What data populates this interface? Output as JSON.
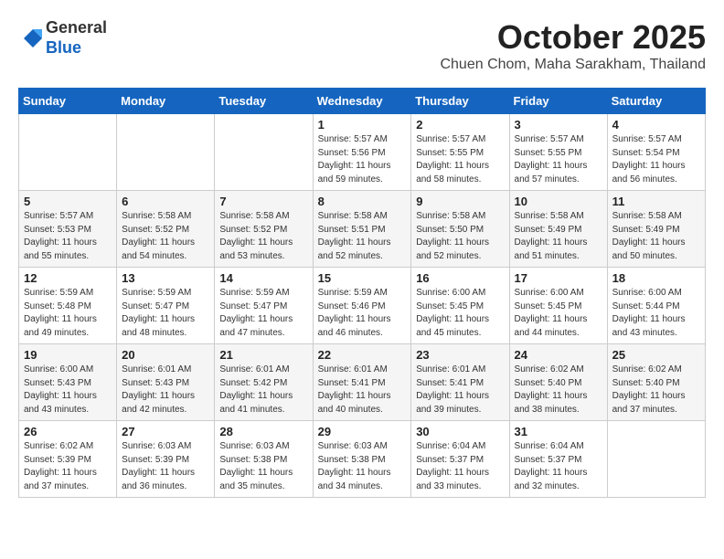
{
  "header": {
    "logo_general": "General",
    "logo_blue": "Blue",
    "month": "October 2025",
    "location": "Chuen Chom, Maha Sarakham, Thailand"
  },
  "days_of_week": [
    "Sunday",
    "Monday",
    "Tuesday",
    "Wednesday",
    "Thursday",
    "Friday",
    "Saturday"
  ],
  "weeks": [
    [
      {
        "day": "",
        "info": ""
      },
      {
        "day": "",
        "info": ""
      },
      {
        "day": "",
        "info": ""
      },
      {
        "day": "1",
        "info": "Sunrise: 5:57 AM\nSunset: 5:56 PM\nDaylight: 11 hours\nand 59 minutes."
      },
      {
        "day": "2",
        "info": "Sunrise: 5:57 AM\nSunset: 5:55 PM\nDaylight: 11 hours\nand 58 minutes."
      },
      {
        "day": "3",
        "info": "Sunrise: 5:57 AM\nSunset: 5:55 PM\nDaylight: 11 hours\nand 57 minutes."
      },
      {
        "day": "4",
        "info": "Sunrise: 5:57 AM\nSunset: 5:54 PM\nDaylight: 11 hours\nand 56 minutes."
      }
    ],
    [
      {
        "day": "5",
        "info": "Sunrise: 5:57 AM\nSunset: 5:53 PM\nDaylight: 11 hours\nand 55 minutes."
      },
      {
        "day": "6",
        "info": "Sunrise: 5:58 AM\nSunset: 5:52 PM\nDaylight: 11 hours\nand 54 minutes."
      },
      {
        "day": "7",
        "info": "Sunrise: 5:58 AM\nSunset: 5:52 PM\nDaylight: 11 hours\nand 53 minutes."
      },
      {
        "day": "8",
        "info": "Sunrise: 5:58 AM\nSunset: 5:51 PM\nDaylight: 11 hours\nand 52 minutes."
      },
      {
        "day": "9",
        "info": "Sunrise: 5:58 AM\nSunset: 5:50 PM\nDaylight: 11 hours\nand 52 minutes."
      },
      {
        "day": "10",
        "info": "Sunrise: 5:58 AM\nSunset: 5:49 PM\nDaylight: 11 hours\nand 51 minutes."
      },
      {
        "day": "11",
        "info": "Sunrise: 5:58 AM\nSunset: 5:49 PM\nDaylight: 11 hours\nand 50 minutes."
      }
    ],
    [
      {
        "day": "12",
        "info": "Sunrise: 5:59 AM\nSunset: 5:48 PM\nDaylight: 11 hours\nand 49 minutes."
      },
      {
        "day": "13",
        "info": "Sunrise: 5:59 AM\nSunset: 5:47 PM\nDaylight: 11 hours\nand 48 minutes."
      },
      {
        "day": "14",
        "info": "Sunrise: 5:59 AM\nSunset: 5:47 PM\nDaylight: 11 hours\nand 47 minutes."
      },
      {
        "day": "15",
        "info": "Sunrise: 5:59 AM\nSunset: 5:46 PM\nDaylight: 11 hours\nand 46 minutes."
      },
      {
        "day": "16",
        "info": "Sunrise: 6:00 AM\nSunset: 5:45 PM\nDaylight: 11 hours\nand 45 minutes."
      },
      {
        "day": "17",
        "info": "Sunrise: 6:00 AM\nSunset: 5:45 PM\nDaylight: 11 hours\nand 44 minutes."
      },
      {
        "day": "18",
        "info": "Sunrise: 6:00 AM\nSunset: 5:44 PM\nDaylight: 11 hours\nand 43 minutes."
      }
    ],
    [
      {
        "day": "19",
        "info": "Sunrise: 6:00 AM\nSunset: 5:43 PM\nDaylight: 11 hours\nand 43 minutes."
      },
      {
        "day": "20",
        "info": "Sunrise: 6:01 AM\nSunset: 5:43 PM\nDaylight: 11 hours\nand 42 minutes."
      },
      {
        "day": "21",
        "info": "Sunrise: 6:01 AM\nSunset: 5:42 PM\nDaylight: 11 hours\nand 41 minutes."
      },
      {
        "day": "22",
        "info": "Sunrise: 6:01 AM\nSunset: 5:41 PM\nDaylight: 11 hours\nand 40 minutes."
      },
      {
        "day": "23",
        "info": "Sunrise: 6:01 AM\nSunset: 5:41 PM\nDaylight: 11 hours\nand 39 minutes."
      },
      {
        "day": "24",
        "info": "Sunrise: 6:02 AM\nSunset: 5:40 PM\nDaylight: 11 hours\nand 38 minutes."
      },
      {
        "day": "25",
        "info": "Sunrise: 6:02 AM\nSunset: 5:40 PM\nDaylight: 11 hours\nand 37 minutes."
      }
    ],
    [
      {
        "day": "26",
        "info": "Sunrise: 6:02 AM\nSunset: 5:39 PM\nDaylight: 11 hours\nand 37 minutes."
      },
      {
        "day": "27",
        "info": "Sunrise: 6:03 AM\nSunset: 5:39 PM\nDaylight: 11 hours\nand 36 minutes."
      },
      {
        "day": "28",
        "info": "Sunrise: 6:03 AM\nSunset: 5:38 PM\nDaylight: 11 hours\nand 35 minutes."
      },
      {
        "day": "29",
        "info": "Sunrise: 6:03 AM\nSunset: 5:38 PM\nDaylight: 11 hours\nand 34 minutes."
      },
      {
        "day": "30",
        "info": "Sunrise: 6:04 AM\nSunset: 5:37 PM\nDaylight: 11 hours\nand 33 minutes."
      },
      {
        "day": "31",
        "info": "Sunrise: 6:04 AM\nSunset: 5:37 PM\nDaylight: 11 hours\nand 32 minutes."
      },
      {
        "day": "",
        "info": ""
      }
    ]
  ]
}
